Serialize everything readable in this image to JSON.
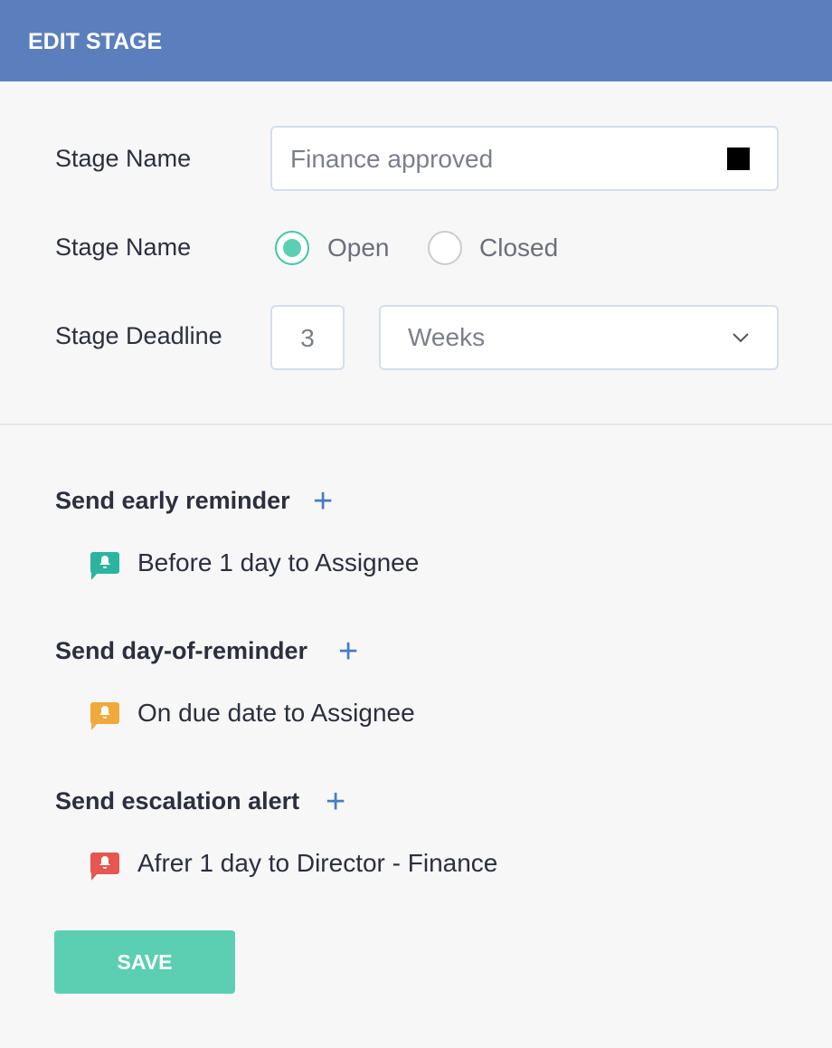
{
  "header": {
    "title": "EDIT STAGE"
  },
  "form": {
    "stage_name_label": "Stage Name",
    "stage_name_value": "Finance approved",
    "stage_color": "#000000",
    "status_label": "Stage Name",
    "status_options": [
      {
        "label": "Open",
        "selected": true
      },
      {
        "label": "Closed",
        "selected": false
      }
    ],
    "deadline_label": "Stage Deadline",
    "deadline_value": "3",
    "deadline_unit": "Weeks"
  },
  "reminders": [
    {
      "title": "Send early reminder",
      "item": "Before 1 day to Assignee",
      "icon": "bell-icon",
      "color": "#2bb5a0"
    },
    {
      "title": "Send day-of-reminder",
      "item": "On due date to Assignee",
      "icon": "bell-icon",
      "color": "#f2a93b"
    },
    {
      "title": "Send escalation alert",
      "item": "Afrer 1 day to Director - Finance",
      "icon": "bell-icon",
      "color": "#e5574f"
    }
  ],
  "actions": {
    "save_label": "SAVE"
  }
}
